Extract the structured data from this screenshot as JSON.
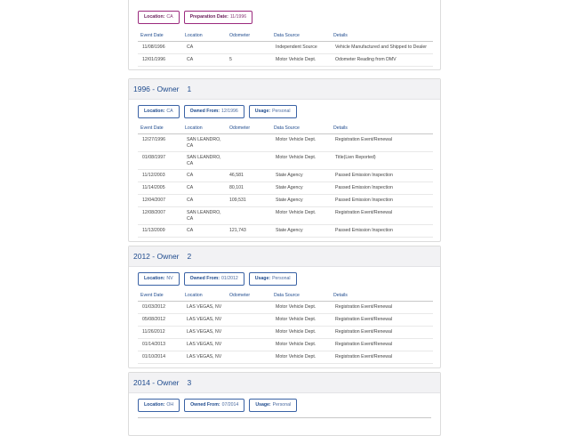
{
  "columns": [
    "Event Date",
    "Location",
    "Odometer",
    "Data Source",
    "Details"
  ],
  "sections": [
    {
      "title": "",
      "owner_num": "",
      "tags": [
        {
          "label": "Location:",
          "value": "CA",
          "style": "purple"
        },
        {
          "label": "Preparation Date:",
          "value": "11/1996",
          "style": "purple"
        }
      ],
      "rows": [
        {
          "date": "11/08/1996",
          "location": "CA",
          "odometer": "",
          "source": "Independent Source",
          "details": "Vehicle Manufactured and Shipped to Dealer"
        },
        {
          "date": "12/01/1996",
          "location": "CA",
          "odometer": "5",
          "source": "Motor Vehicle Dept.",
          "details": "Odometer Reading from DMV"
        }
      ]
    },
    {
      "title": "1996 - Owner",
      "owner_num": "1",
      "tags": [
        {
          "label": "Location:",
          "value": "CA",
          "style": "blue"
        },
        {
          "label": "Owned From:",
          "value": "12/1996",
          "style": "blue"
        },
        {
          "label": "Usage:",
          "value": "Personal",
          "style": "blue"
        }
      ],
      "rows": [
        {
          "date": "12/27/1996",
          "location": "SAN LEANDRO, CA",
          "odometer": "",
          "source": "Motor Vehicle Dept.",
          "details": "Registration Event/Renewal"
        },
        {
          "date": "01/08/1997",
          "location": "SAN LEANDRO, CA",
          "odometer": "",
          "source": "Motor Vehicle Dept.",
          "details": "Title(Lien Reported)"
        },
        {
          "date": "11/12/2003",
          "location": "CA",
          "odometer": "46,581",
          "source": "State Agency",
          "details": "Passed Emission Inspection"
        },
        {
          "date": "11/14/2005",
          "location": "CA",
          "odometer": "80,101",
          "source": "State Agency",
          "details": "Passed Emission Inspection"
        },
        {
          "date": "12/04/2007",
          "location": "CA",
          "odometer": "109,531",
          "source": "State Agency",
          "details": "Passed Emission Inspection"
        },
        {
          "date": "12/08/2007",
          "location": "SAN LEANDRO, CA",
          "odometer": "",
          "source": "Motor Vehicle Dept.",
          "details": "Registration Event/Renewal"
        },
        {
          "date": "11/13/2009",
          "location": "CA",
          "odometer": "121,743",
          "source": "State Agency",
          "details": "Passed Emission Inspection"
        }
      ]
    },
    {
      "title": "2012 - Owner",
      "owner_num": "2",
      "tags": [
        {
          "label": "Location:",
          "value": "NV",
          "style": "blue"
        },
        {
          "label": "Owned From:",
          "value": "01/2012",
          "style": "blue"
        },
        {
          "label": "Usage:",
          "value": "Personal",
          "style": "blue"
        }
      ],
      "rows": [
        {
          "date": "01/03/2012",
          "location": "LAS VEGAS, NV",
          "odometer": "",
          "source": "Motor Vehicle Dept.",
          "details": "Registration Event/Renewal"
        },
        {
          "date": "05/08/2012",
          "location": "LAS VEGAS, NV",
          "odometer": "",
          "source": "Motor Vehicle Dept.",
          "details": "Registration Event/Renewal"
        },
        {
          "date": "11/26/2012",
          "location": "LAS VEGAS, NV",
          "odometer": "",
          "source": "Motor Vehicle Dept.",
          "details": "Registration Event/Renewal"
        },
        {
          "date": "01/14/2013",
          "location": "LAS VEGAS, NV",
          "odometer": "",
          "source": "Motor Vehicle Dept.",
          "details": "Registration Event/Renewal"
        },
        {
          "date": "01/10/2014",
          "location": "LAS VEGAS, NV",
          "odometer": "",
          "source": "Motor Vehicle Dept.",
          "details": "Registration Event/Renewal"
        }
      ]
    },
    {
      "title": "2014 - Owner",
      "owner_num": "3",
      "tags": [
        {
          "label": "Location:",
          "value": "OH",
          "style": "blue"
        },
        {
          "label": "Owned From:",
          "value": "07/2014",
          "style": "blue"
        },
        {
          "label": "Usage:",
          "value": "Personal",
          "style": "blue"
        }
      ],
      "rows": []
    }
  ]
}
